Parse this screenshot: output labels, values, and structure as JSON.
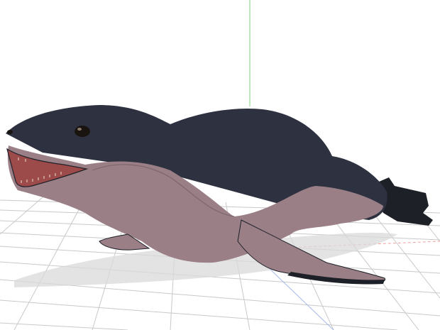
{
  "scene": {
    "background_color": "#ffffff",
    "grid_color": "#c9c9c9",
    "axis_y_color": "#7cd67c",
    "axis_x_color": "#f2a0a0",
    "shadow_color": "#d9d9d9",
    "model": {
      "name_icon": "leopard-seal-model",
      "body_dark_color": "#2e3240",
      "belly_color": "#9a7f86",
      "flipper_color": "#1e2028",
      "mouth_color": "#9c4a4a",
      "eye_color": "#1a1410"
    }
  }
}
